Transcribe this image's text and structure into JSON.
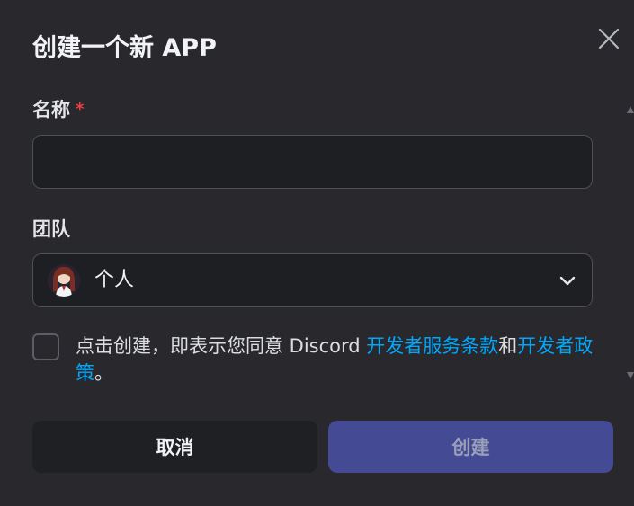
{
  "dialog": {
    "title": "创建一个新 APP",
    "close_icon": "close-icon"
  },
  "form": {
    "name_label": "名称",
    "required_mark": "*",
    "name_value": "",
    "team_label": "团队",
    "team_selected": "个人",
    "team_avatar_icon": "avatar-anime-character",
    "chevron_icon": "chevron-down-icon"
  },
  "agreement": {
    "checked": false,
    "text_prefix": "点击创建，即表示您同意 Discord ",
    "link_terms": "开发者服务条款",
    "conjunction": "和",
    "link_policy": "开发者政策",
    "text_suffix": "。"
  },
  "buttons": {
    "cancel_label": "取消",
    "create_label": "创建"
  },
  "colors": {
    "background": "#28282d",
    "link": "#00a8fc",
    "required": "#f23f43",
    "primary_disabled": "#444a93"
  }
}
